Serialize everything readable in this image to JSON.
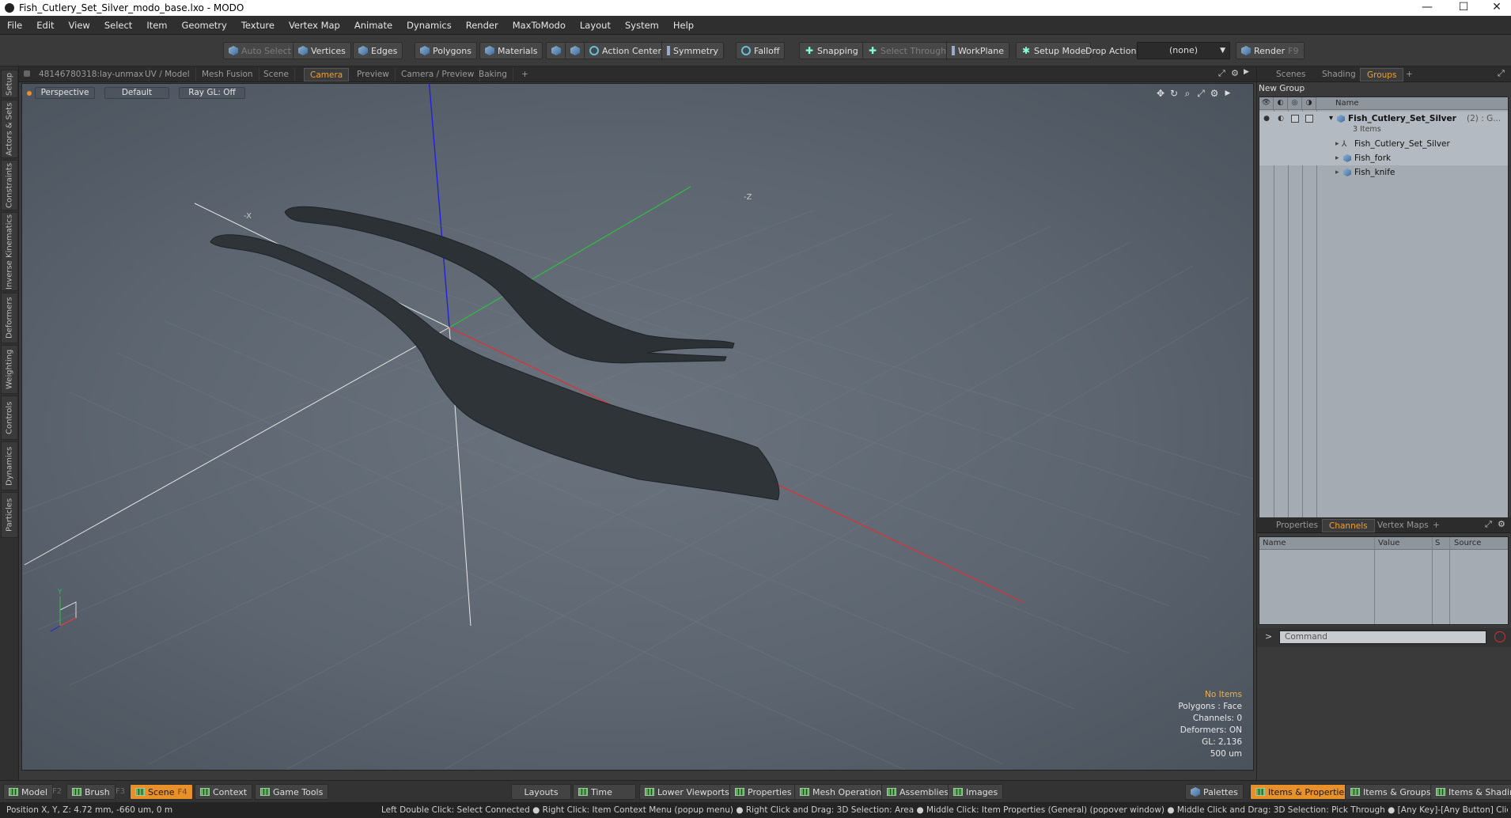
{
  "window": {
    "title": "Fish_Cutlery_Set_Silver_modo_base.lxo - MODO",
    "minimize": "—",
    "maximize": "☐",
    "close": "✕"
  },
  "menu": [
    "File",
    "Edit",
    "View",
    "Select",
    "Item",
    "Geometry",
    "Texture",
    "Vertex Map",
    "Animate",
    "Dynamics",
    "Render",
    "MaxToModo",
    "Layout",
    "System",
    "Help"
  ],
  "toolbar": {
    "auto_select": "Auto Select",
    "vertices": "Vertices",
    "edges": "Edges",
    "polygons": "Polygons",
    "materials": "Materials",
    "action_center": "Action Center",
    "symmetry": "Symmetry",
    "falloff": "Falloff",
    "snapping": "Snapping",
    "select_through": "Select Through",
    "workplane": "WorkPlane",
    "setup_mode": "Setup Mode",
    "drop_action": "Drop Action",
    "drop_value": "(none)",
    "render": "Render",
    "render_key": "F9"
  },
  "left_tabs": [
    "Setup",
    "Actors & Sets",
    "Constraints",
    "Inverse Kinematics",
    "Deformers",
    "Weighting",
    "Controls",
    "Dynamics",
    "Particles"
  ],
  "viewport_tabs": [
    "48146780318:lay-unmax",
    "UV / Model",
    "Mesh Fusion",
    "Scene",
    "Camera",
    "Preview",
    "Camera / Preview",
    "Baking",
    "+"
  ],
  "viewport": {
    "view_mode": "Perspective",
    "style": "Default",
    "raygl": "Ray GL: Off",
    "axis_x_label": "-X",
    "axis_z_label": "-Z",
    "info": {
      "items": "No Items",
      "polygons": "Polygons : Face",
      "channels": "Channels: 0",
      "deformers": "Deformers: ON",
      "gl": "GL: 2,136",
      "scale": "500 um"
    },
    "gizmo_y": "Y"
  },
  "groups_panel": {
    "tabs": [
      "Scenes",
      "Shading",
      "Groups",
      "+"
    ],
    "new_group": "New Group",
    "name_header": "Name",
    "root": {
      "name": "Fish_Cutlery_Set_Silver",
      "suffix": "(2) : G...",
      "count": "3 Items"
    },
    "children": [
      "Fish_Cutlery_Set_Silver",
      "Fish_fork",
      "Fish_knife"
    ]
  },
  "properties_panel": {
    "tabs": [
      "Properties",
      "Channels",
      "Vertex Maps",
      "+"
    ],
    "headers": {
      "name": "Name",
      "value": "Value",
      "s": "S",
      "source": "Source"
    },
    "command_placeholder": "Command",
    "prompt": ">"
  },
  "bottom": {
    "model": "Model",
    "f2": "F2",
    "brush": "Brush",
    "f3": "F3",
    "scene": "Scene",
    "f4": "F4",
    "context": "Context",
    "game_tools": "Game Tools",
    "layouts": "Layouts",
    "time": "Time",
    "lower_viewports": "Lower Viewports",
    "properties": "Properties",
    "mesh_operations": "Mesh Operations",
    "assemblies": "Assemblies",
    "images": "Images",
    "palettes": "Palettes",
    "items_properties": "Items & Properties",
    "items_groups": "Items & Groups",
    "items_shading": "Items & Shading"
  },
  "status": {
    "position": "Position X, Y, Z:   4.72 mm, -660 um, 0 m",
    "hints": "Left Double Click: Select Connected ● Right Click: Item Context Menu (popup menu) ● Right Click and Drag: 3D Selection: Area ● Middle Click: Item Properties (General) (popover window) ● Middle Click and Drag: 3D Selection: Pick Through ● [Any Key]-[Any Button] Click and Drag: dragDropB..."
  },
  "colors": {
    "accent": "#f0a030",
    "axis_x": "#e03030",
    "axis_y": "#30c040",
    "axis_z": "#2020e0",
    "mesh": "#2e3338"
  }
}
